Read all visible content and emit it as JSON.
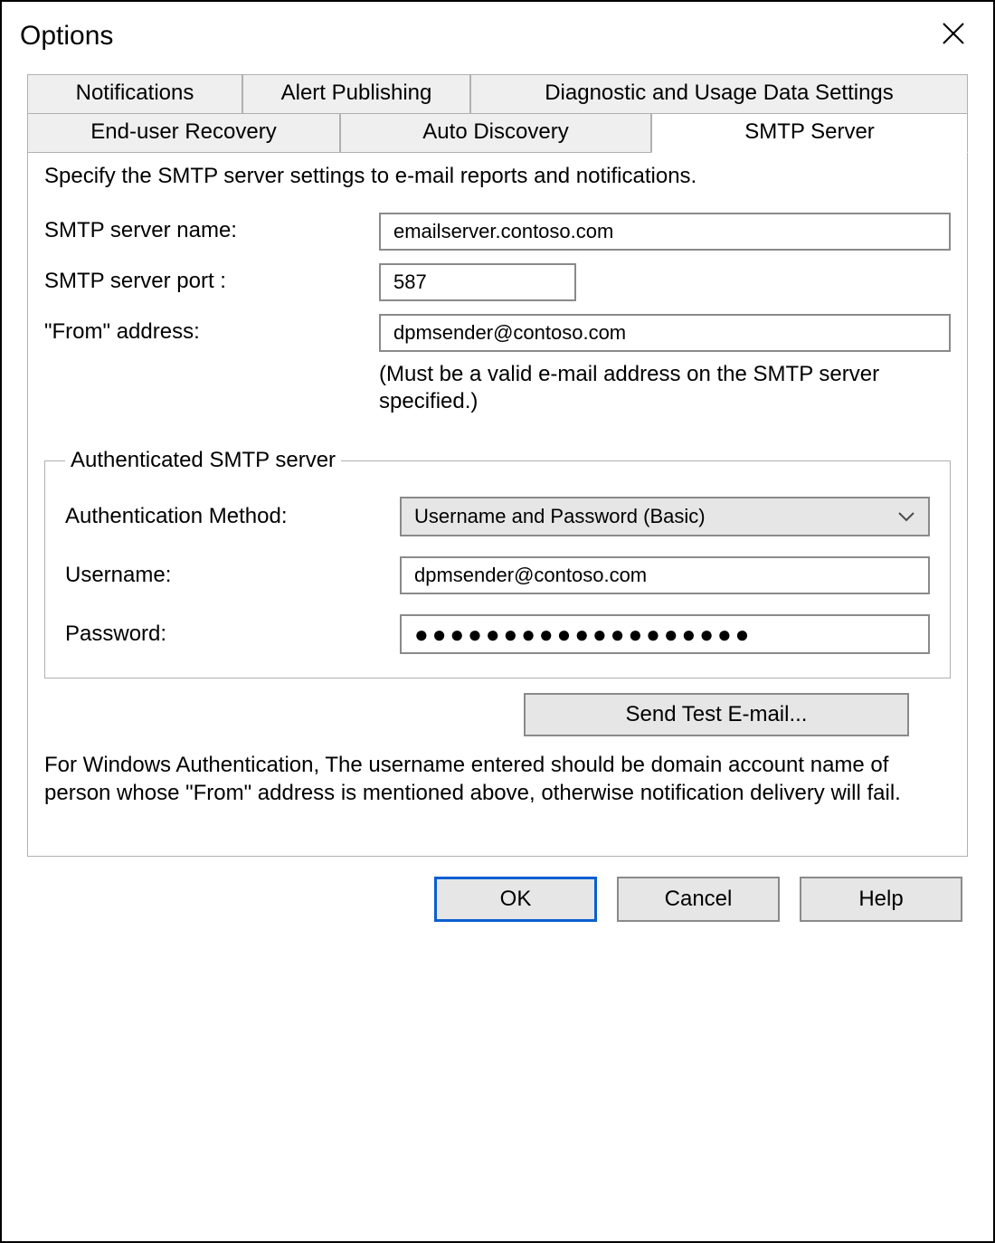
{
  "window": {
    "title": "Options"
  },
  "tabs": {
    "row1": [
      "Notifications",
      "Alert Publishing",
      "Diagnostic and Usage Data Settings"
    ],
    "row2": [
      "End-user Recovery",
      "Auto Discovery",
      "SMTP Server"
    ],
    "active": "SMTP Server"
  },
  "panel": {
    "description": "Specify the SMTP server settings to e-mail reports and notifications.",
    "server_name_label": "SMTP server name:",
    "server_name_value": "emailserver.contoso.com",
    "server_port_label": "SMTP server port :",
    "server_port_value": "587",
    "from_label": "\"From\" address:",
    "from_value": "dpmsender@contoso.com",
    "from_hint": "(Must be a valid e-mail address on the SMTP server specified.)"
  },
  "auth": {
    "group_title": "Authenticated SMTP server",
    "method_label": "Authentication Method:",
    "method_value": "Username and Password (Basic)",
    "username_label": "Username:",
    "username_value": "dpmsender@contoso.com",
    "password_label": "Password:",
    "password_mask": "●●●●●●●●●●●●●●●●●●●"
  },
  "buttons": {
    "send_test": "Send Test E-mail...",
    "ok": "OK",
    "cancel": "Cancel",
    "help": "Help"
  },
  "auth_note": "For Windows Authentication, The username entered should be domain account name of person whose \"From\" address is mentioned above, otherwise notification delivery will fail."
}
